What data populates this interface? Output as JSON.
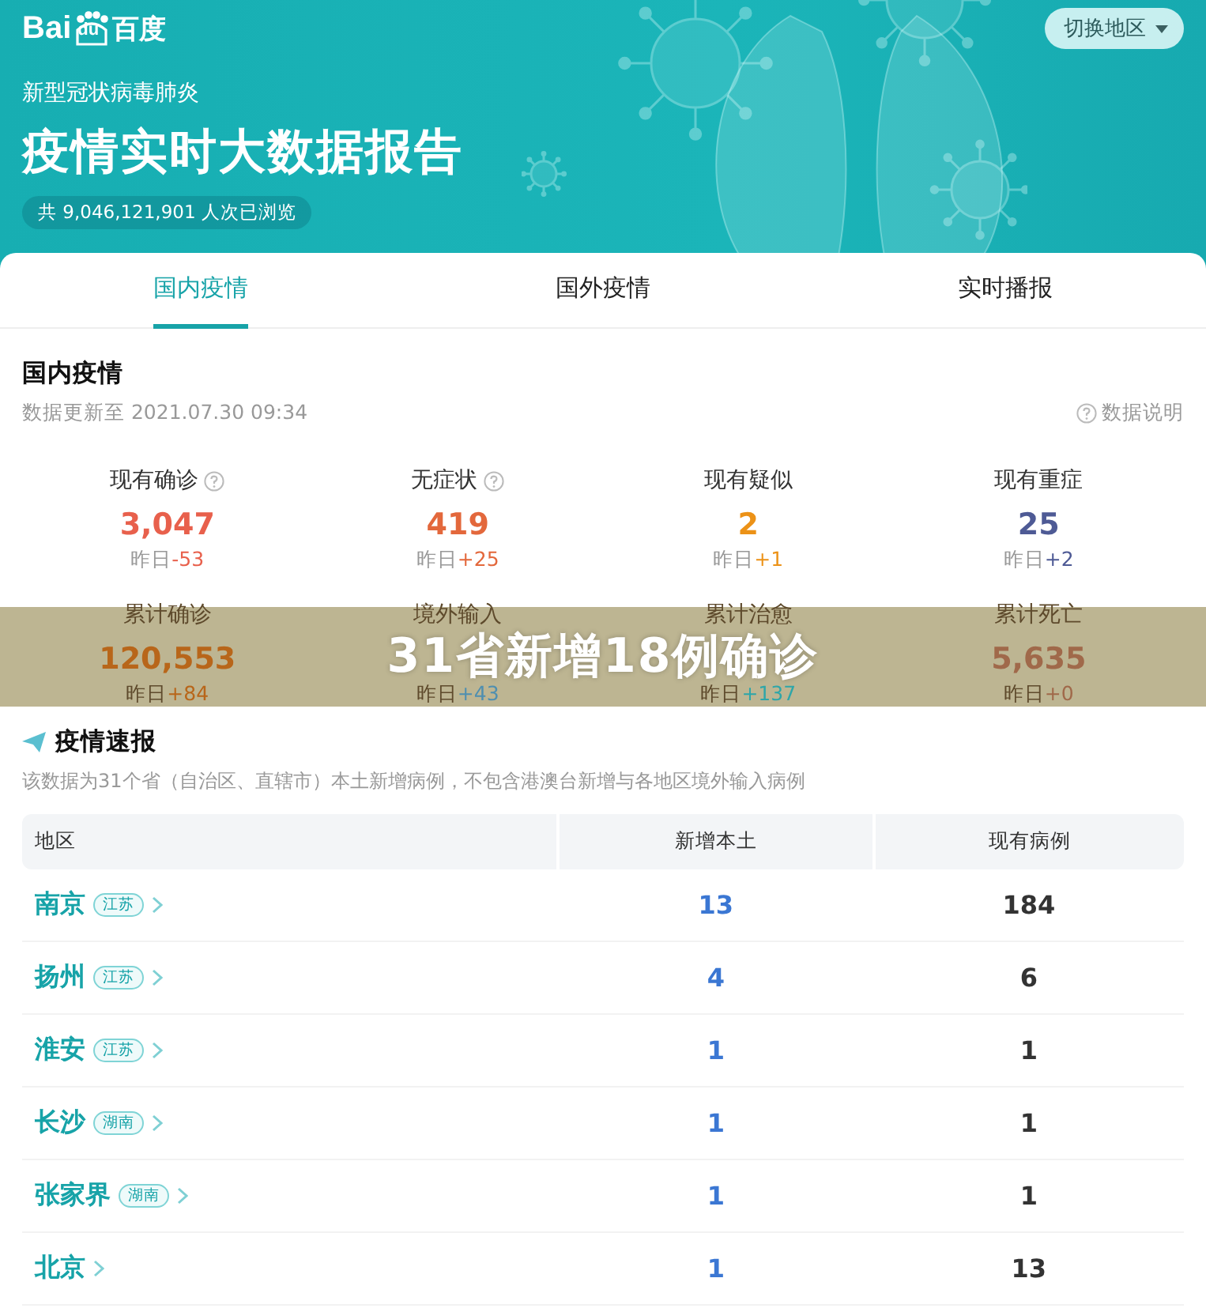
{
  "header": {
    "logo_text": "Bai",
    "logo_paw_text": "du",
    "logo_cn": "百度",
    "region_switch": "切换地区",
    "subtitle": "新型冠状病毒肺炎",
    "title": "疫情实时大数据报告",
    "views": "共 9,046,121,901 人次已浏览"
  },
  "tabs": [
    {
      "label": "国内疫情",
      "selected": true
    },
    {
      "label": "国外疫情",
      "selected": false
    },
    {
      "label": "实时播报",
      "selected": false
    }
  ],
  "domestic": {
    "title": "国内疫情",
    "updated": "数据更新至 2021.07.30 09:34",
    "help": "数据说明",
    "stats": [
      {
        "label": "现有确诊",
        "info": true,
        "value": "3,047",
        "delta_prefix": "昨日",
        "delta": "-53",
        "color": "#e8604c"
      },
      {
        "label": "无症状",
        "info": true,
        "value": "419",
        "delta_prefix": "昨日",
        "delta": "+25",
        "color": "#e3683c"
      },
      {
        "label": "现有疑似",
        "info": false,
        "value": "2",
        "delta_prefix": "昨日",
        "delta": "+1",
        "color": "#ec9217"
      },
      {
        "label": "现有重症",
        "info": false,
        "value": "25",
        "delta_prefix": "昨日",
        "delta": "+2",
        "color": "#4e5a95"
      },
      {
        "label": "累计确诊",
        "info": false,
        "value": "120,553",
        "delta_prefix": "昨日",
        "delta": "+84",
        "color": "#b8661a"
      },
      {
        "label": "境外输入",
        "info": false,
        "delta_prefix": "昨日",
        "delta": "+43",
        "color": "#4f8fb0"
      },
      {
        "label": "累计治愈",
        "info": false,
        "delta_prefix": "昨日",
        "delta": "+137",
        "color": "#2ea6a9"
      },
      {
        "label": "累计死亡",
        "info": false,
        "value": "5,635",
        "delta_prefix": "昨日",
        "delta": "+0",
        "color": "#a0694a"
      }
    ]
  },
  "banner": {
    "text": "31省新增18例确诊"
  },
  "report": {
    "title": "疫情速报",
    "note": "该数据为31个省（自治区、直辖市）本土新增病例，不包含港澳台新增与各地区境外输入病例",
    "columns": [
      "地区",
      "新增本土",
      "现有病例"
    ],
    "rows": [
      {
        "city": "南京",
        "province": "江苏",
        "new_local": "13",
        "current": "184"
      },
      {
        "city": "扬州",
        "province": "江苏",
        "new_local": "4",
        "current": "6"
      },
      {
        "city": "淮安",
        "province": "江苏",
        "new_local": "1",
        "current": "1"
      },
      {
        "city": "长沙",
        "province": "湖南",
        "new_local": "1",
        "current": "1"
      },
      {
        "city": "张家界",
        "province": "湖南",
        "new_local": "1",
        "current": "1"
      },
      {
        "city": "北京",
        "new_local": "1",
        "current": "13"
      }
    ]
  }
}
